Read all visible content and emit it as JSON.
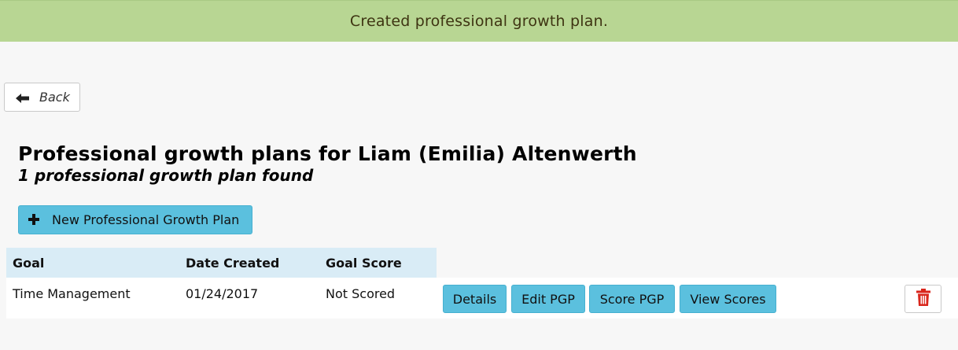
{
  "flash": {
    "message": "Created professional growth plan."
  },
  "nav": {
    "back_label": "Back"
  },
  "header": {
    "title": "Professional growth plans for Liam (Emilia) Altenwerth",
    "subtitle": "1 professional growth plan found"
  },
  "actions": {
    "new_plan_label": "New Professional Growth Plan"
  },
  "table": {
    "columns": [
      "Goal",
      "Date Created",
      "Goal Score"
    ],
    "rows": [
      {
        "goal": "Time Management",
        "date_created": "01/24/2017",
        "goal_score": "Not Scored",
        "buttons": [
          "Details",
          "Edit PGP",
          "Score PGP",
          "View Scores"
        ]
      }
    ]
  },
  "colors": {
    "flash_bg": "#b8d693",
    "button_info": "#5bc0de",
    "header_row_bg": "#d9ecf6",
    "delete_icon": "#d9261c"
  },
  "icons": {
    "back": "arrow-left-icon",
    "new": "plus-icon",
    "delete": "trash-icon"
  }
}
